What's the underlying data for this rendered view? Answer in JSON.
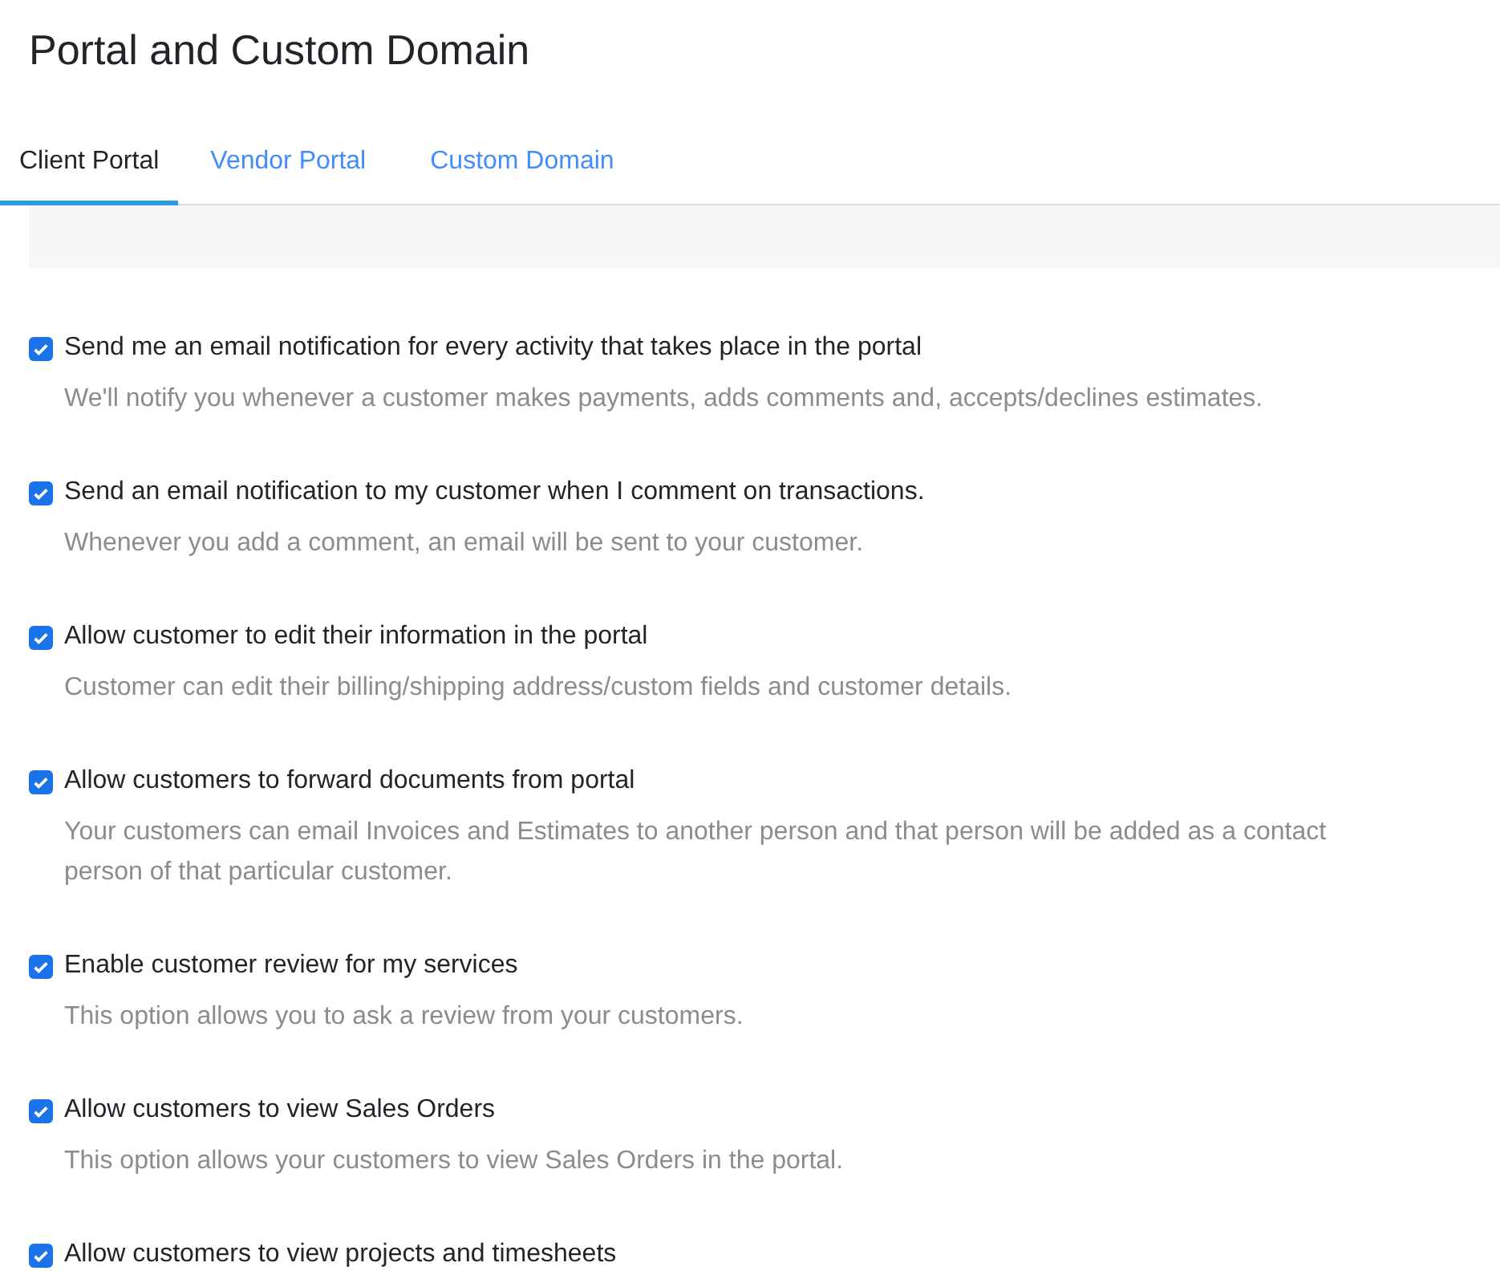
{
  "title": "Portal and Custom Domain",
  "tabs": [
    {
      "label": "Client Portal",
      "selected": true
    },
    {
      "label": "Vendor Portal",
      "selected": false
    },
    {
      "label": "Custom Domain",
      "selected": false
    }
  ],
  "options": [
    {
      "label": "Send me an email notification for every activity that takes place in the portal",
      "description": "We'll notify you whenever a customer makes payments, adds comments and, accepts/declines estimates.",
      "checked": true
    },
    {
      "label": "Send an email notification to my customer when I comment on transactions.",
      "description": "Whenever you add a comment, an email will be sent to your customer.",
      "checked": true
    },
    {
      "label": "Allow customer to edit their information in the portal",
      "description": "Customer can edit their billing/shipping address/custom fields and customer details.",
      "checked": true
    },
    {
      "label": "Allow customers to forward documents from portal",
      "description": "Your customers can email Invoices and Estimates to another person and that person will be added as a contact person of that particular customer.",
      "checked": true
    },
    {
      "label": "Enable customer review for my services",
      "description": "This option allows you to ask a review from your customers.",
      "checked": true
    },
    {
      "label": "Allow customers to view Sales Orders",
      "description": "This option allows your customers to view Sales Orders in the portal.",
      "checked": true
    },
    {
      "label": "Allow customers to view projects and timesheets",
      "checked": true
    }
  ]
}
